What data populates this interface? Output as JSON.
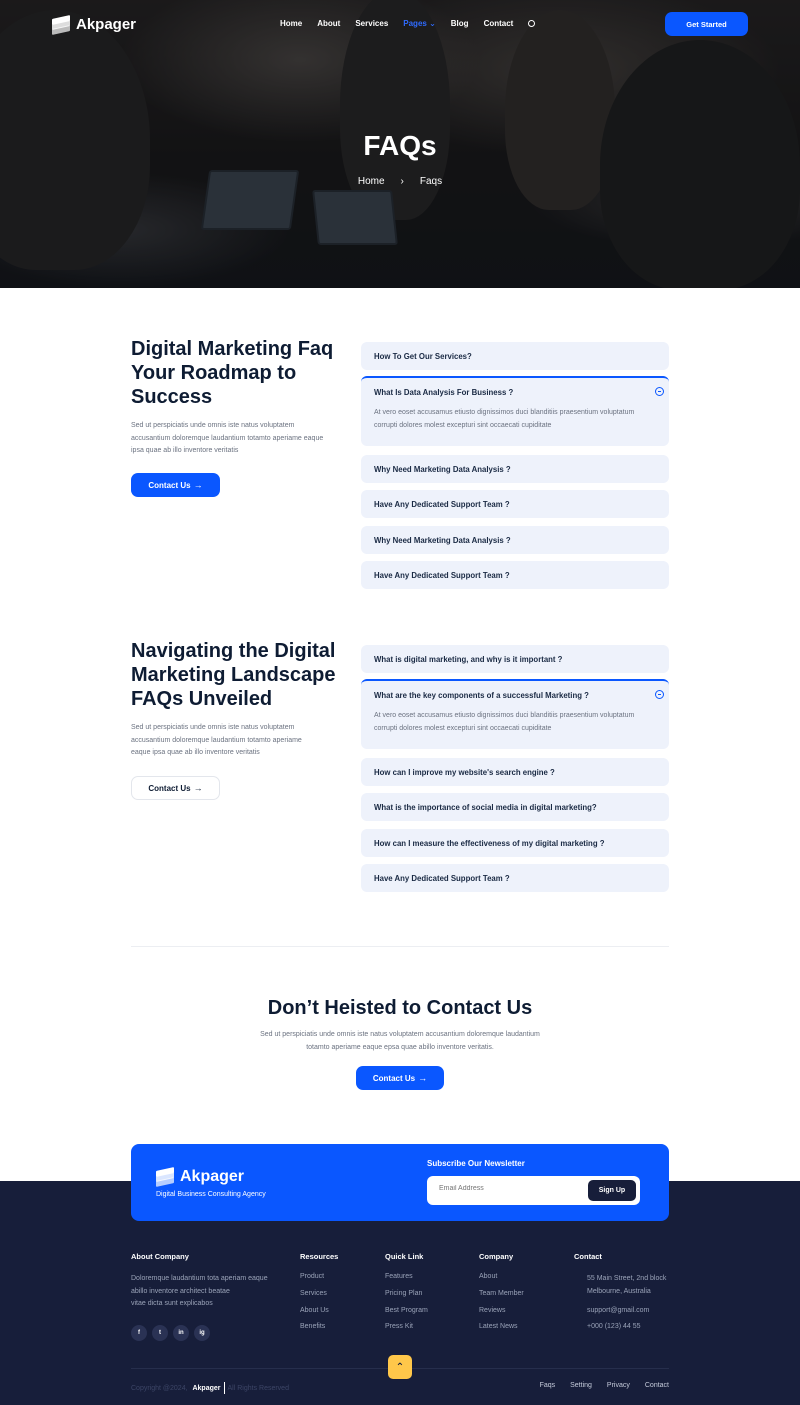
{
  "brand": {
    "name": "Akpager"
  },
  "nav": {
    "items": [
      "Home",
      "About",
      "Services",
      "Pages",
      "Blog",
      "Contact"
    ],
    "cta": "Get Started"
  },
  "hero": {
    "title": "FAQs",
    "crumb_home": "Home",
    "crumb_sep": "›",
    "crumb_current": "Faqs"
  },
  "section1": {
    "title_lines": [
      "Digital Marketing Faq",
      "Your Roadmap to",
      "Success"
    ],
    "desc_lines": [
      "Sed ut perspiciatis unde omnis iste natus voluptatem",
      "accusantium doloremque laudantium totamto aperiame eaque",
      "ipsa quae ab illo inventore veritatis"
    ],
    "button": "Contact Us",
    "faqs": [
      "How To Get Our Services?",
      "What Is Data Analysis For Business ?",
      "Why Need Marketing Data Analysis ?",
      "Have Any Dedicated Support Team ?",
      "Why Need Marketing Data Analysis ?",
      "Have Any Dedicated Support Team ?"
    ],
    "answer_lines": [
      "At vero eoset accusamus etiusto dignissimos duci blanditiis praesentium voluptatum",
      "corrupti dolores molest excepturi sint occaecati cupiditate"
    ]
  },
  "section2": {
    "title_lines": [
      "Navigating the Digital",
      "Marketing Landscape",
      "FAQs Unveiled"
    ],
    "desc_lines": [
      "Sed ut perspiciatis unde omnis iste natus voluptatem",
      "accusantium doloremque laudantium totamto aperiame",
      "eaque ipsa quae ab illo inventore veritatis"
    ],
    "button": "Contact Us",
    "faqs": [
      "What is digital marketing, and why is it important ?",
      "What are the key components of a successful Marketing ?",
      "How can I improve my website's search engine ?",
      "What is the importance of social media in digital marketing?",
      "How can I measure the effectiveness of my digital marketing ?",
      "Have Any Dedicated Support Team ?"
    ],
    "answer_lines": [
      "At vero eoset accusamus etiusto dignissimos duci blanditiis praesentium voluptatum",
      "corrupti dolores molest excepturi sint occaecati cupiditate"
    ]
  },
  "cta": {
    "title": "Don’t Heisted to Contact Us",
    "desc_lines": [
      "Sed ut perspiciatis unde omnis iste natus voluptatem accusantium doloremque laudantium",
      "totamto aperiame eaque epsa quae abillo inventore veritatis."
    ],
    "button": "Contact Us"
  },
  "newsletter": {
    "tagline": "Digital Business Consulting Agency",
    "heading": "Subscribe Our Newsletter",
    "placeholder": "Email Address",
    "button": "Sign Up"
  },
  "footer": {
    "about": {
      "heading": "About Company",
      "text_lines": [
        "Doloremque laudantium tota aperiam eaque",
        "abillo inventore architect beatae",
        "vitae dicta sunt explicabos"
      ],
      "socials": [
        "f",
        "t",
        "in",
        "ig"
      ]
    },
    "resources": {
      "heading": "Resources",
      "links": [
        "Product",
        "Services",
        "About Us",
        "Benefits"
      ]
    },
    "quick": {
      "heading": "Quick Link",
      "links": [
        "Features",
        "Pricing Plan",
        "Best Program",
        "Press Kit"
      ]
    },
    "company": {
      "heading": "Company",
      "links": [
        "About",
        "Team Member",
        "Reviews",
        "Latest News"
      ]
    },
    "contact": {
      "heading": "Contact",
      "address_lines": [
        "55 Main Street, 2nd block",
        "Melbourne, Australia"
      ],
      "email": "support@gmail.com",
      "phone": "+000 (123) 44 55"
    },
    "copyright_prefix": "Copyright @2024,",
    "copyright_brand": "Akpager",
    "copyright_suffix": "All Rights Reserved",
    "bottom_links": [
      "Faqs",
      "Setting",
      "Privacy",
      "Contact"
    ]
  },
  "colors": {
    "accent": "#0a57ff",
    "dark": "#171e3a",
    "faq_bg": "#eef2fb",
    "scroll_top": "#ffc74a"
  }
}
